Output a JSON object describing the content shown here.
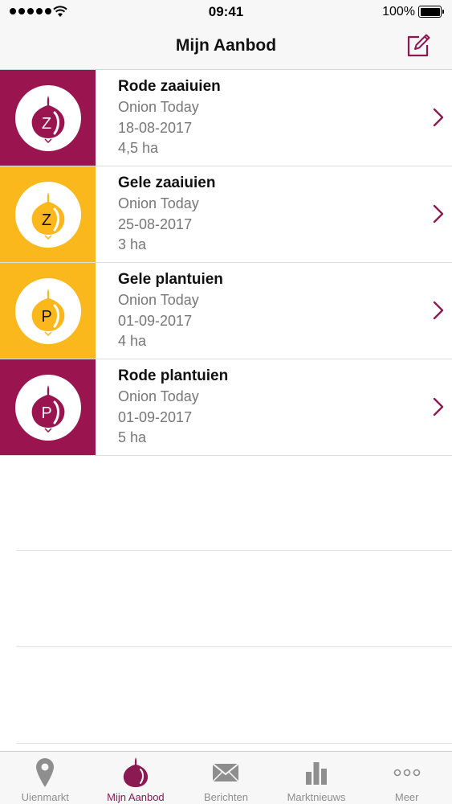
{
  "status_bar": {
    "time": "09:41",
    "battery": "100%"
  },
  "nav": {
    "title": "Mijn Aanbod"
  },
  "colors": {
    "accent": "#8b1a52",
    "red": "#9a1450",
    "yellow": "#fbb81c"
  },
  "offers": [
    {
      "name": "Rode zaaiuien",
      "company": "Onion Today",
      "date": "18-08-2017",
      "area": "4,5 ha",
      "letter": "Z",
      "color": "red"
    },
    {
      "name": "Gele zaaiuien",
      "company": "Onion Today",
      "date": "25-08-2017",
      "area": "3 ha",
      "letter": "Z",
      "color": "yellow"
    },
    {
      "name": "Gele plantuien",
      "company": "Onion Today",
      "date": "01-09-2017",
      "area": "4 ha",
      "letter": "P",
      "color": "yellow"
    },
    {
      "name": "Rode plantuien",
      "company": "Onion Today",
      "date": "01-09-2017",
      "area": "5 ha",
      "letter": "P",
      "color": "red"
    }
  ],
  "tabs": [
    {
      "label": "Uienmarkt",
      "icon": "map-pin-icon"
    },
    {
      "label": "Mijn Aanbod",
      "icon": "onion-icon",
      "active": true
    },
    {
      "label": "Berichten",
      "icon": "envelope-icon"
    },
    {
      "label": "Marktnieuws",
      "icon": "bar-chart-icon"
    },
    {
      "label": "Meer",
      "icon": "more-dots-icon"
    }
  ]
}
